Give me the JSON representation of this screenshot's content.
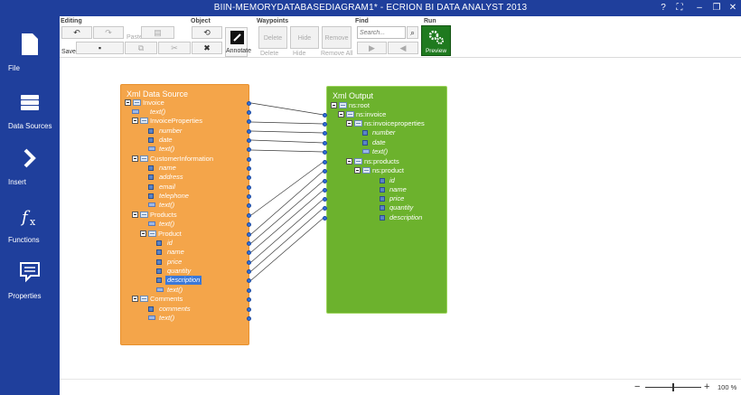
{
  "window": {
    "title": "BIIN-MEMORYDATABASEDIAGRAM1* - ECRION BI DATA ANALYST 2013",
    "help": "?",
    "fullscreen": "⛶",
    "minimize": "–",
    "restore": "❐",
    "close": "✕"
  },
  "sidebar": {
    "file": "File",
    "data_sources": "Data Sources",
    "insert": "Insert",
    "functions": "Functions",
    "properties": "Properties"
  },
  "ribbon": {
    "groups": {
      "editing": "Editing",
      "object": "Object",
      "waypoints": "Waypoints",
      "find": "Find",
      "run": "Run"
    },
    "buttons": {
      "undo": "↶",
      "redo": "↷",
      "paste": "Paste",
      "save": "Save",
      "copy": "⧉",
      "cut": "✂",
      "refresh": "⟲",
      "magic": "✳",
      "delete_obj": "✖",
      "annotate": "Annotate",
      "delete_wp": "Delete",
      "hide_wp": "Hide",
      "remove_wp": "Remove",
      "delete_wp_small": "Delete",
      "hide_wp_small": "Hide",
      "remove_all_wp": "Remove All",
      "search_icon": "⌕",
      "find_next": "▶",
      "find_prev": "◀",
      "preview": "Preview"
    },
    "search": {
      "placeholder": "Search...",
      "value": ""
    }
  },
  "source_panel": {
    "title": "Xml Data Source",
    "nodes": [
      "Invoice",
      "text()",
      "InvoiceProperties",
      "number",
      "date",
      "text()",
      "CustomerInformation",
      "name",
      "address",
      "email",
      "telephone",
      "text()",
      "Products",
      "text()",
      "Product",
      "id",
      "name",
      "price",
      "quantity",
      "description",
      "text()",
      "Comments",
      "comments",
      "text()"
    ],
    "selected": "description"
  },
  "output_panel": {
    "title": "Xml Output",
    "nodes": [
      "ns:root",
      "ns:invoice",
      "ns:invoiceproperties",
      "number",
      "date",
      "text()",
      "ns:products",
      "ns:product",
      "id",
      "name",
      "price",
      "quantity",
      "description"
    ]
  },
  "statusbar": {
    "zoom_out": "−",
    "zoom_in": "+",
    "zoom_level": "100 %",
    "zoom_fraction": 0.5
  },
  "colors": {
    "chrome": "#1f3f9c",
    "source_panel": "#f4a54a",
    "output_panel": "#6cb22d",
    "preview_button": "#1f7a1f",
    "selection": "#3b78d8",
    "port": "#2f6fd8"
  }
}
